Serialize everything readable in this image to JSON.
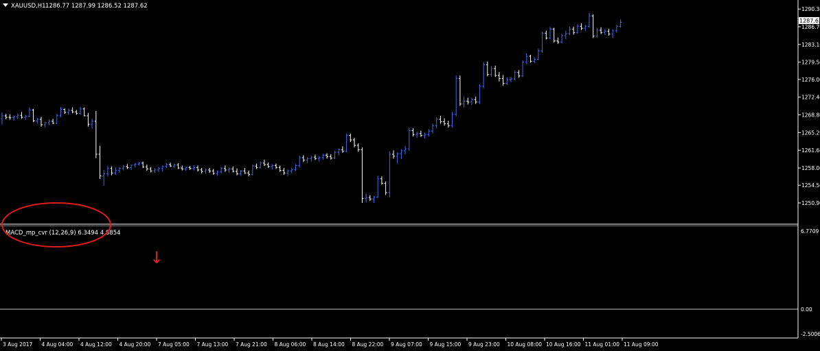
{
  "header": {
    "symbol": "XAUUSD,H1",
    "ohlc": "1286.77 1287.99 1286.52 1287.62"
  },
  "indicator": {
    "label": "MACD_mp_cvr (12,26,9) 6.3494 4.8854",
    "arrow_glyph": "↓"
  },
  "colors": {
    "background": "#000000",
    "up_bar": "#3a6df0",
    "down_bar": "#ffffff",
    "neutral_bar": "#00c040",
    "grid": "#1e2a3a",
    "axis": "#ffffff",
    "annotation": "#e11b1b",
    "price_tag_bg": "#ffffff",
    "price_tag_fg": "#000000"
  },
  "chart_data": [
    {
      "type": "ohlc",
      "symbol": "XAUUSD",
      "timeframe": "H1",
      "current_price": "1287.62",
      "ylim": [
        1247.0,
        1291.3
      ],
      "y_ticks": [
        "1290.30",
        "1286.70",
        "1283.10",
        "1279.50",
        "1276.00",
        "1272.40",
        "1268.80",
        "1265.20",
        "1261.60",
        "1258.00",
        "1254.50",
        "1250.90"
      ],
      "x_ticks": [
        "3 Aug 2017",
        "4 Aug 04:00",
        "4 Aug 12:00",
        "4 Aug 20:00",
        "7 Aug 05:00",
        "7 Aug 13:00",
        "7 Aug 21:00",
        "8 Aug 06:00",
        "8 Aug 14:00",
        "8 Aug 22:00",
        "9 Aug 07:00",
        "9 Aug 15:00",
        "9 Aug 23:00",
        "10 Aug 08:00",
        "10 Aug 16:00",
        "11 Aug 01:00",
        "11 Aug 09:00"
      ],
      "y_ticks_lower": [
        "6.7709",
        "0.00",
        "-2.5006"
      ],
      "bars": [
        [
          1268.0,
          1269.3,
          1266.8,
          1268.6
        ],
        [
          1268.6,
          1269.0,
          1267.9,
          1268.3
        ],
        [
          1268.3,
          1268.9,
          1267.8,
          1268.2
        ],
        [
          1268.2,
          1268.7,
          1267.6,
          1268.4
        ],
        [
          1268.4,
          1269.1,
          1267.9,
          1268.7
        ],
        [
          1268.7,
          1269.4,
          1268.0,
          1268.3
        ],
        [
          1268.3,
          1268.8,
          1267.8,
          1268.5
        ],
        [
          1268.5,
          1270.3,
          1268.3,
          1269.8
        ],
        [
          1269.8,
          1270.0,
          1267.3,
          1267.6
        ],
        [
          1267.6,
          1268.2,
          1267.0,
          1267.9
        ],
        [
          1267.9,
          1268.4,
          1266.4,
          1266.8
        ],
        [
          1266.8,
          1267.4,
          1266.2,
          1267.2
        ],
        [
          1267.2,
          1267.9,
          1266.7,
          1267.5
        ],
        [
          1267.5,
          1268.0,
          1266.9,
          1267.1
        ],
        [
          1267.1,
          1269.0,
          1266.9,
          1268.7
        ],
        [
          1268.7,
          1270.4,
          1268.3,
          1269.9
        ],
        [
          1269.9,
          1270.1,
          1269.0,
          1269.3
        ],
        [
          1269.3,
          1270.1,
          1268.8,
          1269.7
        ],
        [
          1269.7,
          1270.3,
          1269.1,
          1269.4
        ],
        [
          1269.4,
          1269.8,
          1268.8,
          1269.1
        ],
        [
          1269.1,
          1270.4,
          1268.8,
          1270.0
        ],
        [
          1270.0,
          1270.3,
          1268.5,
          1268.6
        ],
        [
          1268.6,
          1269.2,
          1266.4,
          1266.9
        ],
        [
          1266.9,
          1268.0,
          1266.0,
          1267.5
        ],
        [
          1267.5,
          1269.6,
          1260.0,
          1260.8
        ],
        [
          1260.8,
          1262.5,
          1255.8,
          1256.4
        ],
        [
          1256.4,
          1257.6,
          1254.4,
          1256.8
        ],
        [
          1256.8,
          1258.4,
          1256.3,
          1257.9
        ],
        [
          1257.9,
          1258.3,
          1256.5,
          1257.0
        ],
        [
          1257.0,
          1258.1,
          1256.6,
          1257.5
        ],
        [
          1257.5,
          1258.2,
          1257.0,
          1257.9
        ],
        [
          1257.9,
          1258.6,
          1257.5,
          1258.3
        ],
        [
          1258.3,
          1258.8,
          1257.8,
          1258.1
        ],
        [
          1258.1,
          1258.6,
          1257.6,
          1258.6
        ],
        [
          1258.6,
          1259.0,
          1258.1,
          1258.8
        ],
        [
          1258.8,
          1259.2,
          1258.5,
          1259.0
        ],
        [
          1259.0,
          1259.3,
          1258.0,
          1258.2
        ],
        [
          1258.2,
          1258.7,
          1257.4,
          1257.8
        ],
        [
          1257.8,
          1258.2,
          1257.1,
          1257.4
        ],
        [
          1257.4,
          1258.0,
          1257.0,
          1257.6
        ],
        [
          1257.6,
          1258.2,
          1257.2,
          1257.9
        ],
        [
          1257.9,
          1258.5,
          1257.3,
          1258.3
        ],
        [
          1258.3,
          1259.0,
          1258.0,
          1258.7
        ],
        [
          1258.7,
          1259.1,
          1258.2,
          1258.4
        ],
        [
          1258.4,
          1258.9,
          1258.0,
          1258.6
        ],
        [
          1258.6,
          1259.0,
          1257.8,
          1258.0
        ],
        [
          1258.0,
          1258.5,
          1257.5,
          1257.8
        ],
        [
          1257.8,
          1258.3,
          1257.4,
          1258.1
        ],
        [
          1258.1,
          1258.4,
          1257.6,
          1257.9
        ],
        [
          1257.9,
          1258.6,
          1257.5,
          1258.1
        ],
        [
          1258.1,
          1258.5,
          1257.3,
          1257.6
        ],
        [
          1257.6,
          1258.0,
          1256.9,
          1257.3
        ],
        [
          1257.3,
          1257.9,
          1256.8,
          1257.6
        ],
        [
          1257.6,
          1258.0,
          1257.0,
          1257.4
        ],
        [
          1257.4,
          1257.8,
          1256.6,
          1256.9
        ],
        [
          1256.9,
          1257.5,
          1256.4,
          1257.2
        ],
        [
          1257.2,
          1258.2,
          1256.9,
          1257.9
        ],
        [
          1257.9,
          1258.5,
          1257.2,
          1257.6
        ],
        [
          1257.6,
          1258.1,
          1257.0,
          1257.8
        ],
        [
          1257.8,
          1258.3,
          1257.1,
          1257.3
        ],
        [
          1257.3,
          1257.9,
          1256.5,
          1256.8
        ],
        [
          1256.8,
          1257.6,
          1256.4,
          1257.4
        ],
        [
          1257.4,
          1258.0,
          1256.8,
          1257.0
        ],
        [
          1257.0,
          1257.5,
          1256.3,
          1256.7
        ],
        [
          1256.7,
          1258.7,
          1256.5,
          1258.4
        ],
        [
          1258.4,
          1258.9,
          1257.8,
          1258.1
        ],
        [
          1258.1,
          1259.3,
          1257.9,
          1259.0
        ],
        [
          1259.0,
          1259.7,
          1258.4,
          1258.7
        ],
        [
          1258.7,
          1259.1,
          1258.0,
          1258.3
        ],
        [
          1258.3,
          1258.8,
          1257.7,
          1258.5
        ],
        [
          1258.5,
          1258.9,
          1257.8,
          1258.1
        ],
        [
          1258.1,
          1258.5,
          1257.2,
          1257.5
        ],
        [
          1257.5,
          1258.0,
          1256.6,
          1257.0
        ],
        [
          1257.0,
          1257.7,
          1256.4,
          1257.4
        ],
        [
          1257.4,
          1258.1,
          1256.9,
          1257.7
        ],
        [
          1257.7,
          1258.8,
          1257.4,
          1258.5
        ],
        [
          1258.5,
          1260.5,
          1258.1,
          1260.1
        ],
        [
          1260.1,
          1260.6,
          1259.2,
          1259.6
        ],
        [
          1259.6,
          1260.2,
          1259.0,
          1259.9
        ],
        [
          1259.9,
          1260.5,
          1259.3,
          1260.2
        ],
        [
          1260.2,
          1260.7,
          1259.6,
          1259.9
        ],
        [
          1259.9,
          1260.4,
          1259.3,
          1260.1
        ],
        [
          1260.1,
          1260.9,
          1259.7,
          1260.6
        ],
        [
          1260.6,
          1261.0,
          1259.9,
          1260.3
        ],
        [
          1260.3,
          1260.8,
          1259.7,
          1260.0
        ],
        [
          1260.0,
          1261.5,
          1259.8,
          1261.2
        ],
        [
          1261.2,
          1262.0,
          1260.6,
          1261.7
        ],
        [
          1261.7,
          1262.4,
          1261.1,
          1261.4
        ],
        [
          1261.4,
          1265.0,
          1261.2,
          1264.6
        ],
        [
          1264.6,
          1265.0,
          1263.3,
          1263.7
        ],
        [
          1263.7,
          1264.1,
          1262.2,
          1262.6
        ],
        [
          1262.6,
          1263.0,
          1261.3,
          1261.7
        ],
        [
          1261.7,
          1262.2,
          1250.9,
          1251.8
        ],
        [
          1251.8,
          1252.8,
          1251.0,
          1252.0
        ],
        [
          1252.0,
          1252.5,
          1251.3,
          1251.7
        ],
        [
          1251.7,
          1252.3,
          1250.9,
          1252.1
        ],
        [
          1252.1,
          1256.4,
          1251.9,
          1255.8
        ],
        [
          1255.8,
          1256.3,
          1254.6,
          1254.9
        ],
        [
          1254.9,
          1255.3,
          1252.5,
          1253.0
        ],
        [
          1253.0,
          1261.4,
          1252.0,
          1260.8
        ],
        [
          1260.8,
          1261.6,
          1259.9,
          1260.4
        ],
        [
          1260.4,
          1261.2,
          1258.9,
          1260.9
        ],
        [
          1260.9,
          1261.8,
          1259.8,
          1261.5
        ],
        [
          1261.5,
          1262.5,
          1260.8,
          1261.9
        ],
        [
          1261.9,
          1266.2,
          1261.5,
          1265.6
        ],
        [
          1265.6,
          1266.1,
          1264.4,
          1264.8
        ],
        [
          1264.8,
          1265.4,
          1264.1,
          1265.0
        ],
        [
          1265.0,
          1265.6,
          1264.3,
          1264.6
        ],
        [
          1264.6,
          1265.2,
          1264.0,
          1264.8
        ],
        [
          1264.8,
          1265.9,
          1264.4,
          1265.5
        ],
        [
          1265.5,
          1267.0,
          1265.0,
          1266.6
        ],
        [
          1266.6,
          1268.3,
          1266.1,
          1267.9
        ],
        [
          1267.9,
          1268.6,
          1267.0,
          1267.4
        ],
        [
          1267.4,
          1268.1,
          1266.6,
          1267.0
        ],
        [
          1267.0,
          1267.6,
          1266.2,
          1266.6
        ],
        [
          1266.6,
          1269.4,
          1266.2,
          1268.9
        ],
        [
          1268.9,
          1276.8,
          1268.5,
          1276.2
        ],
        [
          1276.2,
          1276.8,
          1270.6,
          1271.0
        ],
        [
          1271.0,
          1272.5,
          1270.3,
          1271.6
        ],
        [
          1271.6,
          1272.3,
          1270.9,
          1271.4
        ],
        [
          1271.4,
          1272.3,
          1270.8,
          1271.9
        ],
        [
          1271.9,
          1272.5,
          1271.0,
          1271.4
        ],
        [
          1271.4,
          1275.0,
          1271.0,
          1274.6
        ],
        [
          1274.6,
          1279.5,
          1274.2,
          1279.0
        ],
        [
          1279.0,
          1279.6,
          1276.6,
          1277.0
        ],
        [
          1277.0,
          1278.7,
          1276.5,
          1278.2
        ],
        [
          1278.2,
          1278.8,
          1276.5,
          1276.8
        ],
        [
          1276.8,
          1277.5,
          1275.6,
          1276.2
        ],
        [
          1276.2,
          1276.9,
          1274.7,
          1275.2
        ],
        [
          1275.2,
          1276.4,
          1274.9,
          1275.9
        ],
        [
          1275.9,
          1276.5,
          1275.4,
          1276.1
        ],
        [
          1276.1,
          1277.8,
          1275.8,
          1277.4
        ],
        [
          1277.4,
          1277.9,
          1276.3,
          1276.7
        ],
        [
          1276.7,
          1279.9,
          1276.5,
          1279.5
        ],
        [
          1279.5,
          1281.3,
          1279.1,
          1280.7
        ],
        [
          1280.7,
          1281.0,
          1279.4,
          1279.7
        ],
        [
          1279.7,
          1280.5,
          1279.3,
          1280.1
        ],
        [
          1280.1,
          1282.3,
          1279.9,
          1281.8
        ],
        [
          1281.8,
          1285.7,
          1281.4,
          1285.4
        ],
        [
          1285.4,
          1285.9,
          1284.1,
          1284.4
        ],
        [
          1284.4,
          1286.7,
          1284.2,
          1286.2
        ],
        [
          1286.2,
          1286.5,
          1283.5,
          1283.8
        ],
        [
          1283.8,
          1284.5,
          1283.2,
          1283.6
        ],
        [
          1283.6,
          1285.3,
          1283.3,
          1284.9
        ],
        [
          1284.9,
          1285.9,
          1284.2,
          1285.3
        ],
        [
          1285.3,
          1286.7,
          1285.0,
          1286.2
        ],
        [
          1286.2,
          1286.7,
          1285.1,
          1285.5
        ],
        [
          1285.5,
          1287.2,
          1285.3,
          1286.8
        ],
        [
          1286.8,
          1287.4,
          1286.0,
          1286.4
        ],
        [
          1286.4,
          1287.1,
          1285.8,
          1286.8
        ],
        [
          1286.8,
          1289.5,
          1286.5,
          1288.9
        ],
        [
          1288.9,
          1289.2,
          1284.4,
          1284.8
        ],
        [
          1284.8,
          1286.4,
          1284.5,
          1286.0
        ],
        [
          1286.0,
          1286.6,
          1285.2,
          1285.5
        ],
        [
          1285.5,
          1286.2,
          1285.0,
          1285.8
        ],
        [
          1285.8,
          1286.3,
          1284.9,
          1285.2
        ],
        [
          1285.2,
          1286.2,
          1284.4,
          1285.9
        ],
        [
          1285.9,
          1287.0,
          1285.5,
          1286.8
        ],
        [
          1286.8,
          1288.2,
          1286.5,
          1287.6
        ]
      ]
    }
  ]
}
